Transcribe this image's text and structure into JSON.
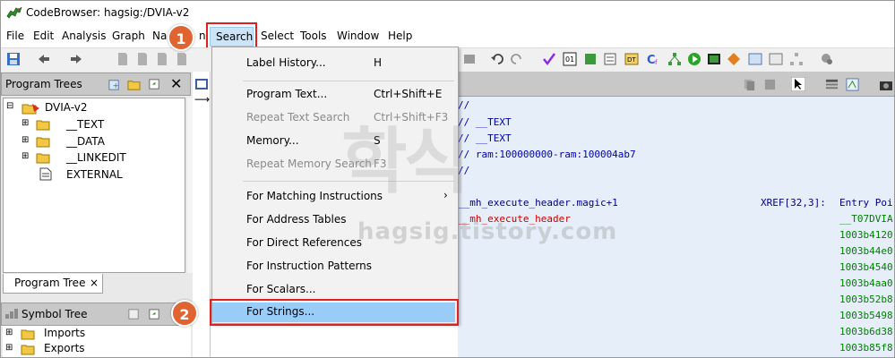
{
  "window": {
    "title": "CodeBrowser: hagsig:/DVIA-v2"
  },
  "menubar": {
    "items": [
      "File",
      "Edit",
      "Analysis",
      "Graph",
      "Na",
      "n",
      "Select",
      "Tools",
      "Window",
      "Help"
    ],
    "active": "Search"
  },
  "program_trees": {
    "title": "Program Trees",
    "root": "DVIA-v2",
    "children": [
      "__TEXT",
      "__DATA",
      "__LINKEDIT",
      "EXTERNAL"
    ],
    "tab_label": "Program Tree",
    "tab_close": "×"
  },
  "symbol_tree": {
    "title": "Symbol Tree",
    "items": [
      "Imports",
      "Exports"
    ]
  },
  "search_menu": {
    "items": [
      {
        "label": "Label History...",
        "shortcut": "H",
        "enabled": true
      },
      {
        "label": "Program Text...",
        "shortcut": "Ctrl+Shift+E",
        "enabled": true
      },
      {
        "label": "Repeat Text Search",
        "shortcut": "Ctrl+Shift+F3",
        "enabled": false
      },
      {
        "label": "Memory...",
        "shortcut": "S",
        "enabled": true
      },
      {
        "label": "Repeat Memory Search",
        "shortcut": "F3",
        "enabled": false
      },
      {
        "label": "For Matching Instructions",
        "shortcut": "›",
        "enabled": true
      },
      {
        "label": "For Address Tables",
        "shortcut": "",
        "enabled": true
      },
      {
        "label": "For Direct References",
        "shortcut": "",
        "enabled": true
      },
      {
        "label": "For Instruction Patterns",
        "shortcut": "",
        "enabled": true
      },
      {
        "label": "For Scalars...",
        "shortcut": "",
        "enabled": true
      },
      {
        "label": "For Strings...",
        "shortcut": "",
        "enabled": true
      }
    ]
  },
  "listing": {
    "comments": [
      "//",
      "// __TEXT",
      "// __TEXT",
      "// ram:100000000-ram:100004ab7",
      "//"
    ],
    "label_magic": "__mh_execute_header.magic+1",
    "label_header": "__mh_execute_header",
    "xref": "XREF[32,3]:",
    "entry": "Entry Poi",
    "xref_first": "__T07DVIA",
    "addresses": [
      "1003b4120",
      "1003b44e0",
      "1003b4540",
      "1003b4aa0",
      "1003b52b8",
      "1003b5498",
      "1003b6d38",
      "1003b85f8"
    ]
  },
  "annotations": {
    "step1": "1",
    "step2": "2"
  },
  "watermark": {
    "big": "학식",
    "url": "hagsig.tistory.com"
  },
  "colors": {
    "highlight": "#99ccf7",
    "box": "#e02020",
    "badge": "#e06432",
    "listing_bg": "#e6eef9"
  }
}
